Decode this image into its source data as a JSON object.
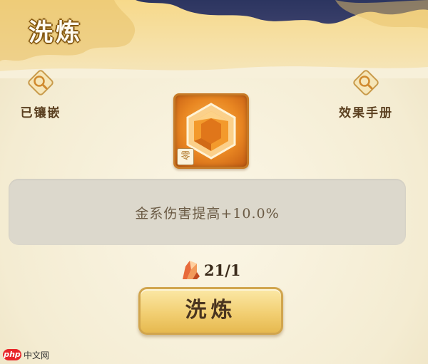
{
  "header": {
    "title": "洗炼"
  },
  "left_button": {
    "label": "已镶嵌",
    "icon": "magnifier-icon"
  },
  "right_button": {
    "label": "效果手册",
    "icon": "magnifier-icon"
  },
  "gem": {
    "icon": "hexagon-gem-icon",
    "badge": "零"
  },
  "effect": {
    "text": "金系伤害提高+10.0%"
  },
  "cost": {
    "icon": "crystal-icon",
    "value": "21/1"
  },
  "action": {
    "label": "洗炼"
  },
  "watermark": {
    "logo": "php",
    "text": "中文网"
  },
  "colors": {
    "accent": "#e98722",
    "button": "#f2cf73",
    "panel": "#dcd8cc"
  }
}
